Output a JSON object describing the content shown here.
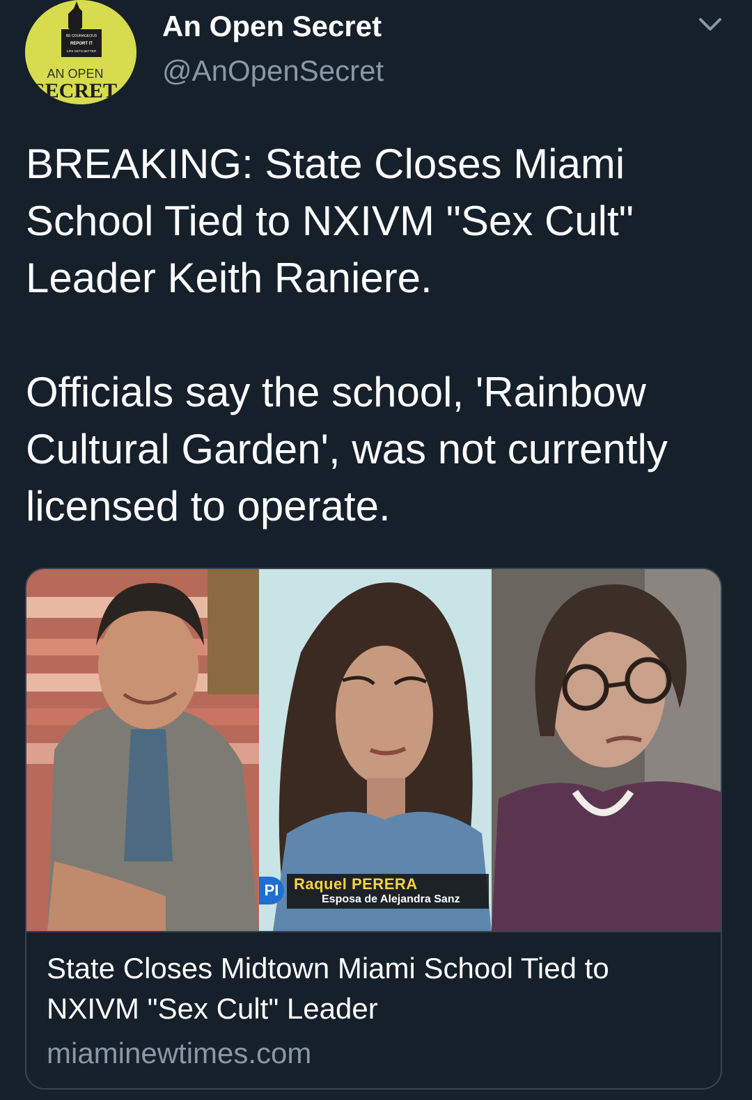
{
  "header": {
    "display_name": "An Open Secret",
    "handle": "@AnOpenSecret",
    "avatar": {
      "line1": "BE COURAGEOUS",
      "line2": "REPORT IT",
      "line3": "LIFE GETS BETTER",
      "line4": "AN OPEN",
      "line5": "SECRET",
      "color": "#d6dc4e"
    },
    "menu_icon": "chevron-down-icon"
  },
  "tweet": {
    "paragraph1": "BREAKING: State Closes Miami School Tied to NXIVM \"Sex Cult\" Leader Keith Raniere.",
    "paragraph2": "Officials say the school, 'Rainbow Cultural Garden', was not currently licensed to operate."
  },
  "card": {
    "lower_third_logo": "PI",
    "lower_third_name": "Raquel PERERA",
    "lower_third_subtitle": "Esposa de Alejandra Sanz",
    "title": "State Closes Midtown Miami School Tied to NXIVM \"Sex Cult\" Leader",
    "domain": "miaminewtimes.com"
  },
  "colors": {
    "background": "#15202b",
    "secondary_text": "#8899a6",
    "border": "#38444d"
  }
}
